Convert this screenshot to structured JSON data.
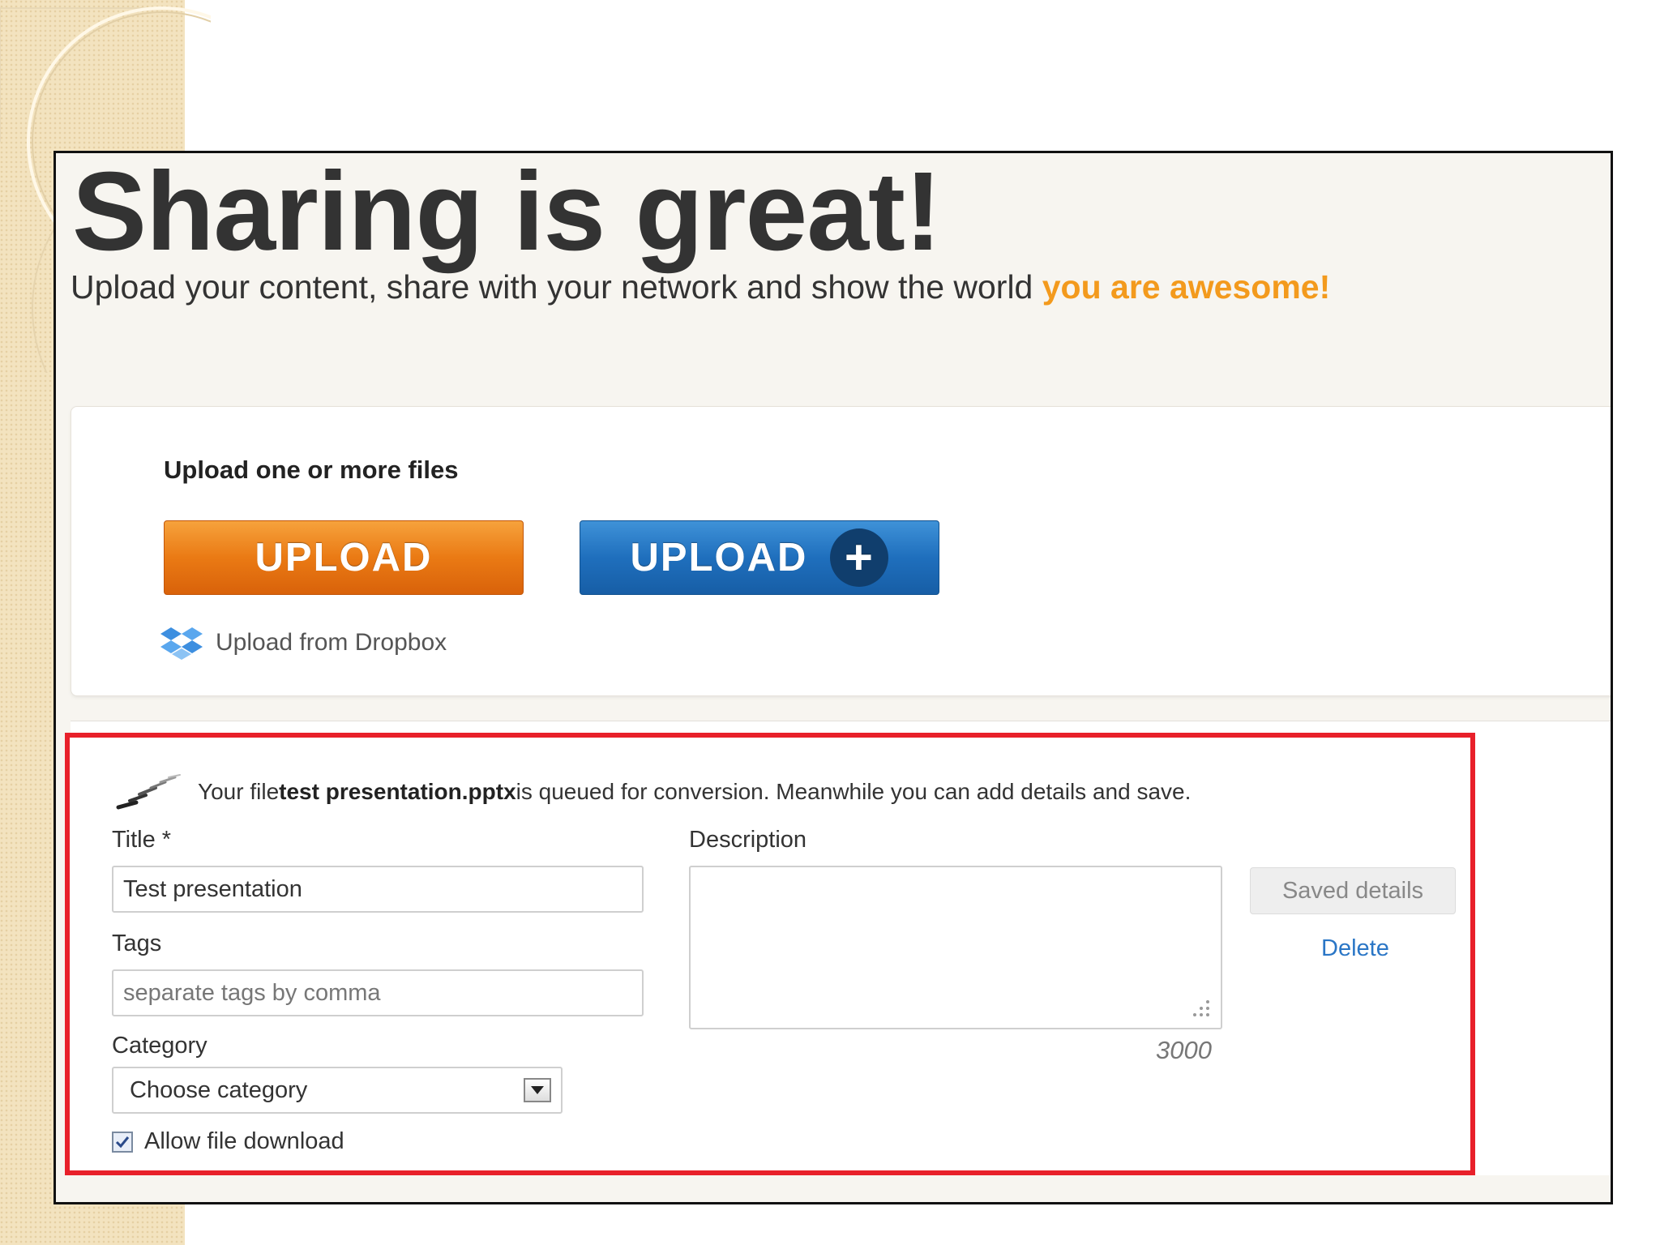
{
  "hero": {
    "title": "Sharing is great!",
    "subtitle": "Upload your content, share with your network and show the world ",
    "subtitle_accent": "you are awesome!"
  },
  "upload_panel": {
    "heading": "Upload one or more files",
    "upload_button": "UPLOAD",
    "upload_plus_button": "UPLOAD",
    "plus_symbol": "+",
    "dropbox_link": "Upload from Dropbox"
  },
  "queue": {
    "prefix": "Your file ",
    "filename": "test presentation.pptx",
    "suffix": " is queued for conversion. Meanwhile you can add details and save."
  },
  "form": {
    "title_label": "Title *",
    "title_value": "Test presentation",
    "tags_label": "Tags",
    "tags_placeholder": "separate tags by comma",
    "category_label": "Category",
    "category_value": "Choose category",
    "description_label": "Description",
    "description_char_count": "3000",
    "saved_button": "Saved details",
    "delete_link": "Delete",
    "allow_download_label": "Allow file download",
    "allow_download_checked": true
  },
  "colors": {
    "accent_orange": "#f39a1d",
    "upload_orange": "#ea7a14",
    "upload_blue": "#1f6fbd",
    "highlight_red": "#e8202a",
    "link_blue": "#2a76c6"
  },
  "icons": {
    "dropbox": "dropbox-icon",
    "spinner": "loading-spinner-icon",
    "dropdown": "chevron-down-icon",
    "check": "check-icon"
  }
}
